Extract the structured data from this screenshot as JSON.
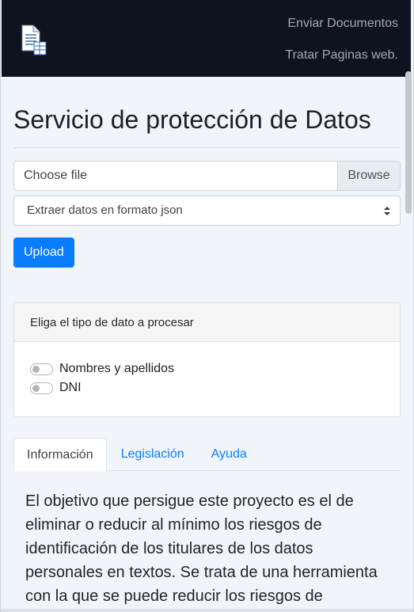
{
  "navbar": {
    "logo_icon": "document-icon",
    "links": [
      "Enviar Documentos",
      "Tratar Paginas web."
    ]
  },
  "page": {
    "title": "Servicio de protección de Datos"
  },
  "upload_form": {
    "file_placeholder": "Choose file",
    "browse_label": "Browse",
    "format_selected": "Extraer datos en formato json",
    "upload_label": "Upload"
  },
  "data_type_card": {
    "header": "Eliga el tipo de dato a procesar",
    "options": [
      {
        "label": "Nombres y apellidos",
        "checked": false
      },
      {
        "label": "DNI",
        "checked": false
      }
    ]
  },
  "tabs": {
    "items": [
      "Información",
      "Legislación",
      "Ayuda"
    ],
    "active": "Información"
  },
  "info_text": "El objetivo que persigue este proyecto es el de eliminar o reducir al mínimo los riesgos de identificación de los titulares de los datos personales en textos. Se trata de una herramienta con la que se puede reducir los riesgos de",
  "colors": {
    "navbar_bg": "#0f1320",
    "primary": "#0a7cff",
    "page_bg": "#f1f5fa"
  }
}
